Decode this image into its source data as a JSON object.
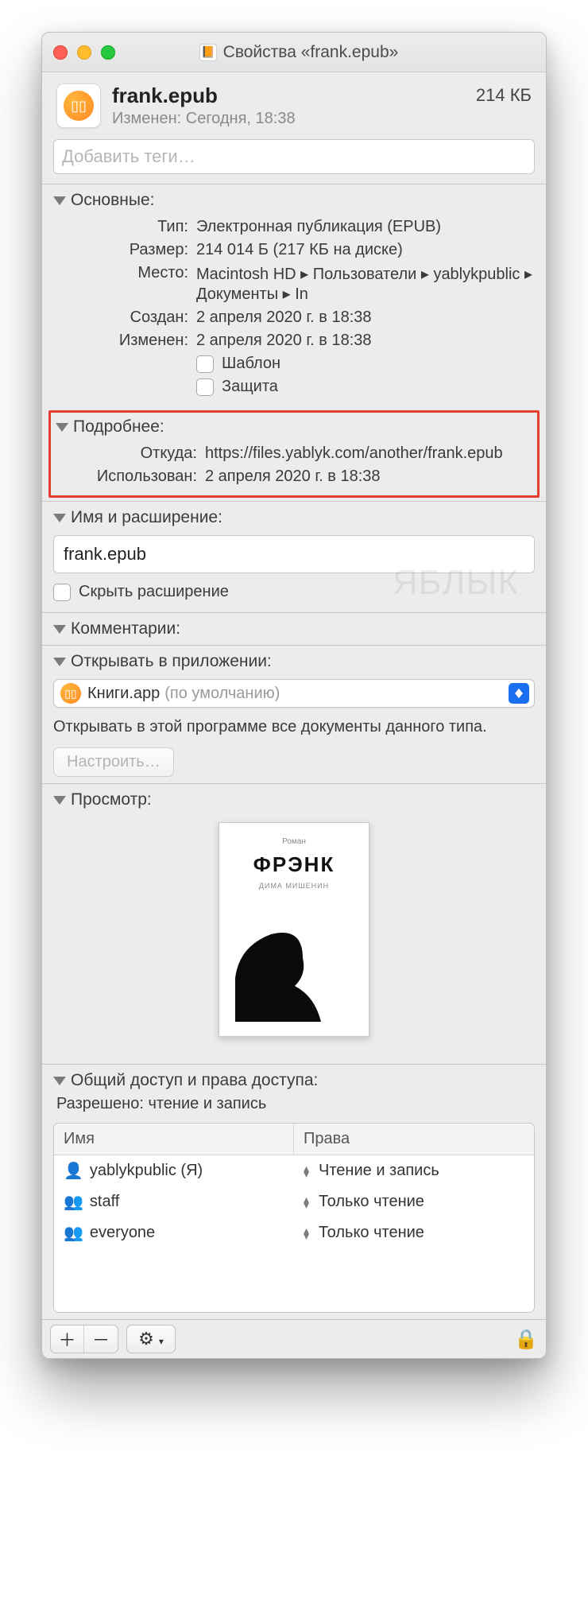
{
  "window": {
    "title": "Свойства «frank.epub»"
  },
  "header": {
    "filename": "frank.epub",
    "modified_label": "Изменен:",
    "modified_value": "Сегодня, 18:38",
    "size": "214 КБ"
  },
  "tags": {
    "placeholder": "Добавить теги…"
  },
  "general": {
    "title": "Основные:",
    "type_k": "Тип:",
    "type_v": "Электронная публикация (EPUB)",
    "size_k": "Размер:",
    "size_v": "214 014 Б (217 КБ на диске)",
    "where_k": "Место:",
    "where_v": "Macintosh HD ▸ Пользователи ▸ yablykpublic ▸ Документы ▸ In",
    "created_k": "Создан:",
    "created_v": "2 апреля 2020 г. в 18:38",
    "mod_k": "Изменен:",
    "mod_v": "2 апреля 2020 г. в 18:38",
    "stationery": "Шаблон",
    "locked": "Защита"
  },
  "more": {
    "title": "Подробнее:",
    "from_k": "Откуда:",
    "from_v": "https://files.yablyk.com/another/frank.epub",
    "used_k": "Использован:",
    "used_v": "2 апреля 2020 г. в 18:38"
  },
  "nameext": {
    "title": "Имя и расширение:",
    "value": "frank.epub",
    "hide": "Скрыть расширение"
  },
  "comments": {
    "title": "Комментарии:"
  },
  "openwith": {
    "title": "Открывать в приложении:",
    "app": "Книги.app",
    "default": "(по умолчанию)",
    "note": "Открывать в этой программе все документы данного типа.",
    "change": "Настроить…"
  },
  "preview": {
    "title": "Просмотр:",
    "cover_top": "Роман",
    "cover_title": "ФРЭНК",
    "cover_sub": "ДИМА МИШЕНИН"
  },
  "sharing": {
    "title": "Общий доступ и права доступа:",
    "allowed": "Разрешено: чтение и запись",
    "col_name": "Имя",
    "col_perm": "Права",
    "rows": [
      {
        "name": "yablykpublic (Я)",
        "perm": "Чтение и запись"
      },
      {
        "name": "staff",
        "perm": "Только чтение"
      },
      {
        "name": "everyone",
        "perm": "Только чтение"
      }
    ]
  },
  "watermark": "ЯБЛЫК"
}
